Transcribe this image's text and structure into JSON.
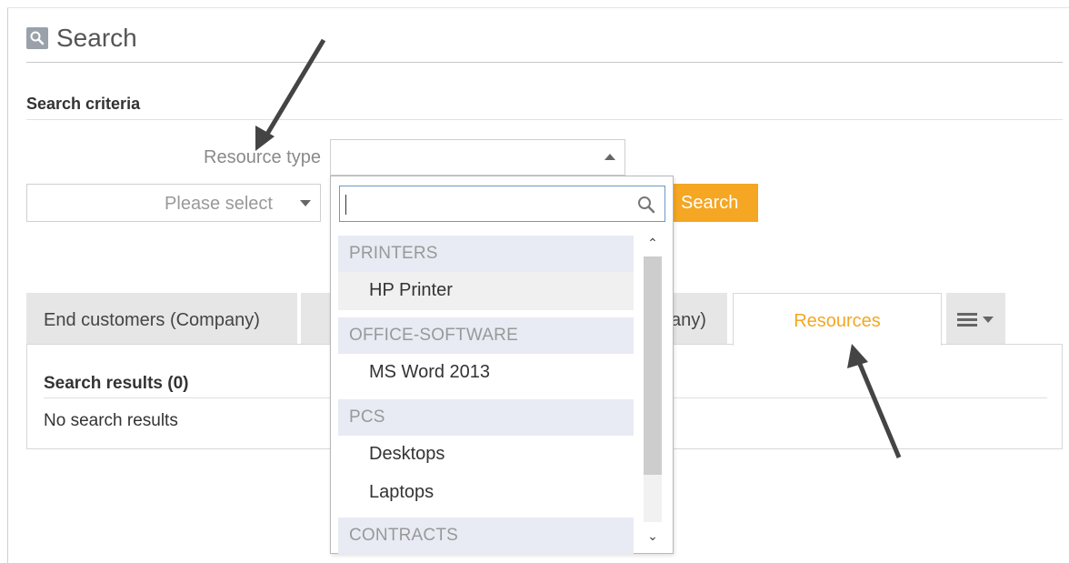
{
  "page": {
    "title": "Search"
  },
  "search_criteria": {
    "heading": "Search criteria",
    "resource_type_label": "Resource type",
    "resource_type_value": "",
    "secondary_select": "Please select",
    "search_button": "Search"
  },
  "tabs": [
    {
      "label": "End customers (Company)",
      "active": false
    },
    {
      "label": "",
      "active": false
    },
    {
      "label": "any)",
      "active": false
    },
    {
      "label": "Resources",
      "active": true
    }
  ],
  "tab_menu_icon": "list-menu-icon",
  "results": {
    "title": "Search results (0)",
    "empty_text": "No search results"
  },
  "dropdown": {
    "search_value": "",
    "groups": [
      {
        "label": "PRINTERS",
        "items": [
          "HP Printer"
        ]
      },
      {
        "label": "OFFICE-SOFTWARE",
        "items": [
          "MS Word 2013"
        ]
      },
      {
        "label": "PCS",
        "items": [
          "Desktops",
          "Laptops"
        ]
      },
      {
        "label": "CONTRACTS",
        "items": []
      }
    ],
    "highlighted_item": "HP Printer"
  },
  "colors": {
    "accent": "#f5a623",
    "group_bg": "#e8ebf3",
    "focus_border": "#6d97c8"
  }
}
